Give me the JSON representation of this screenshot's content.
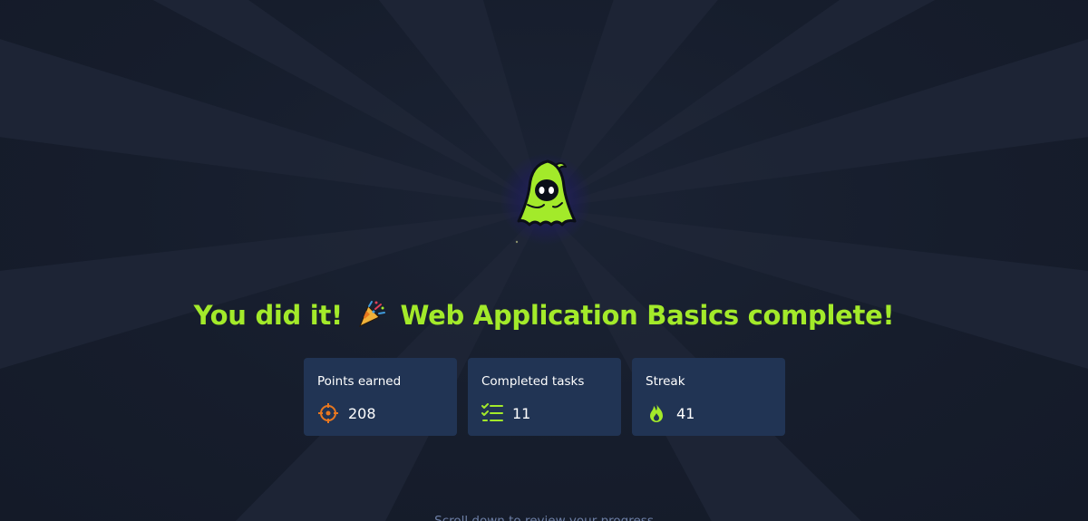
{
  "headline": {
    "prefix": "You did it!",
    "suffix": "Web Application Basics complete!",
    "party_icon": "party-popper-icon"
  },
  "mascot": {
    "icon": "hooded-ghost-mascot-icon"
  },
  "stats": [
    {
      "label": "Points earned",
      "value": "208",
      "icon": "crosshair-target-icon",
      "icon_color": "#e8771f"
    },
    {
      "label": "Completed tasks",
      "value": "11",
      "icon": "checklist-icon",
      "icon_color": "#a3ea2a"
    },
    {
      "label": "Streak",
      "value": "41",
      "icon": "flame-icon",
      "icon_color": "#a3ea2a"
    }
  ],
  "scroll_hint": "Scroll down to review your progress",
  "colors": {
    "background": "#151c2b",
    "accent": "#a3ea2a",
    "card": "#213454",
    "points_icon": "#e8771f"
  }
}
